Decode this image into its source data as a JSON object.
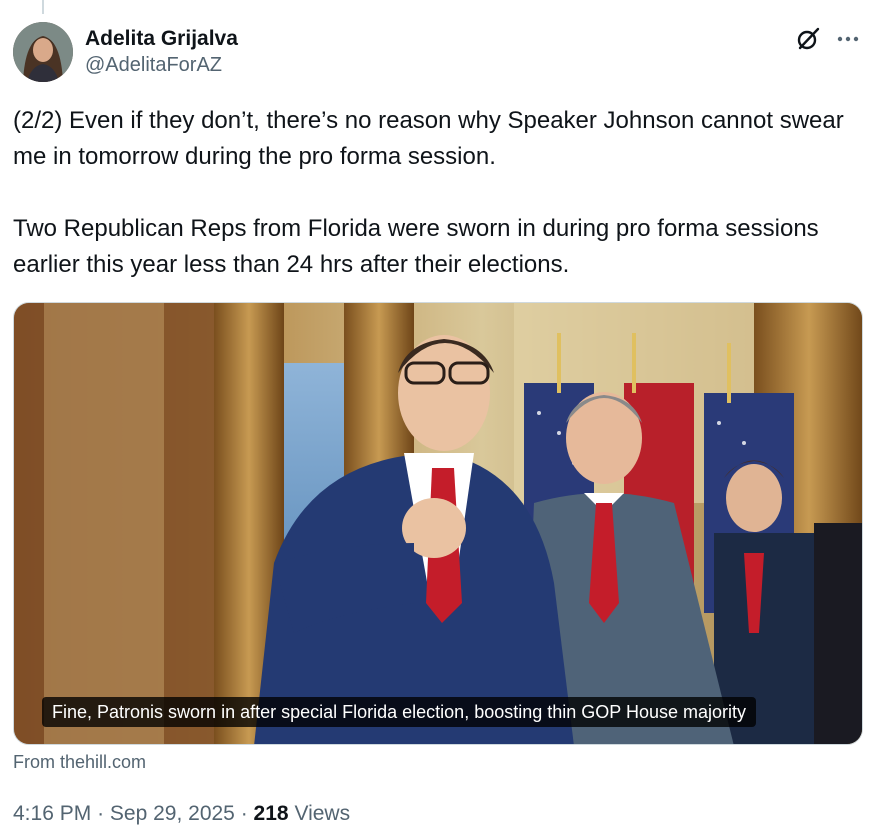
{
  "author": {
    "display_name": "Adelita Grijalva",
    "handle": "@AdelitaForAZ"
  },
  "header_icons": {
    "grok": "grok-icon",
    "more": "more-dots-icon"
  },
  "tweet": {
    "paragraph_1": "(2/2) Even if they don’t, there’s no reason why Speaker Johnson cannot swear me in tomorrow during the pro forma session.",
    "paragraph_2": "Two Republican Reps from Florida were sworn in during pro forma sessions earlier this year less than 24 hrs after their elections."
  },
  "link_card": {
    "headline": "Fine, Patronis sworn in after special Florida election, boosting thin GOP House majority",
    "source": "From thehill.com"
  },
  "meta": {
    "time": "4:16 PM",
    "separator": "·",
    "date": "Sep 29, 2025",
    "views_count": "218",
    "views_label": "Views"
  },
  "colors": {
    "text_primary": "#0f1419",
    "text_secondary": "#536471",
    "border": "#cfd9de"
  }
}
